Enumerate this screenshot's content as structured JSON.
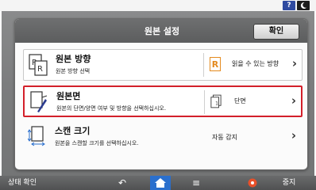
{
  "system_bar": {
    "help_label": "?",
    "night_icon": "moon-icon"
  },
  "dialog": {
    "title": "원본 설정",
    "ok_label": "확인"
  },
  "rows": [
    {
      "title": "원본 방향",
      "description": "원본 방향 선택",
      "icon": "original-orientation-icon",
      "value_icon_letter": "R",
      "value": "읽을 수 있는 방향"
    },
    {
      "title": "원본면",
      "description": "원본의 단면/양면 여부 및 방향을 선택하십시오.",
      "icon": "original-sides-icon",
      "value": "단면",
      "selected": true
    },
    {
      "title": "스캔 크기",
      "description": "원본을 스캔할 크기를 선택하십시오.",
      "icon": "scan-size-icon",
      "value": "자동 감지"
    }
  ],
  "bottom_bar": {
    "status_label": "상태 확인",
    "stop_label": "중지"
  },
  "colors": {
    "highlight_border": "#d31f2a",
    "home_button": "#2a6fcd",
    "orientation_accent": "#e48a1e",
    "stop_icon": "#e8502a"
  }
}
